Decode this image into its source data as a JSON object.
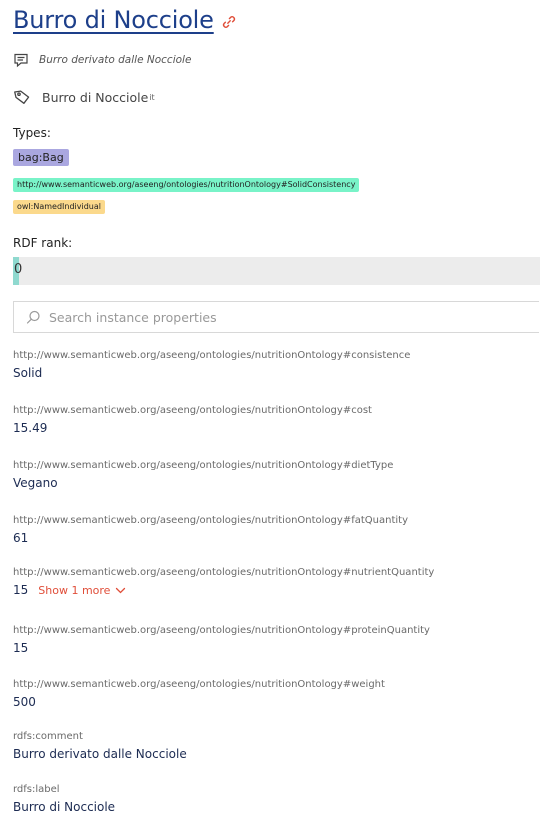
{
  "header": {
    "title": "Burro di Nocciole",
    "link_icon": "link-icon"
  },
  "description": {
    "icon": "comment-icon",
    "text": "Burro derivato dalle Nocciole"
  },
  "label": {
    "icon": "tag-icon",
    "text": "Burro di Nocciole",
    "lang": "it"
  },
  "types": {
    "heading": "Types:",
    "items": [
      {
        "label": "bag:Bag",
        "color": "#aaa7e0"
      },
      {
        "label": "http://www.semanticweb.org/aseeng/ontologies/nutritionOntology#SolidConsistency",
        "color": "#79f3c8"
      },
      {
        "label": "owl:NamedIndividual",
        "color": "#fbd98c"
      }
    ]
  },
  "rdf_rank": {
    "heading": "RDF rank:",
    "value": "0",
    "fill_color": "#8fd9cf"
  },
  "search": {
    "placeholder": "Search instance properties",
    "icon": "search-icon"
  },
  "properties": [
    {
      "key": "http://www.semanticweb.org/aseeng/ontologies/nutritionOntology#consistence",
      "value": "Solid"
    },
    {
      "key": "http://www.semanticweb.org/aseeng/ontologies/nutritionOntology#cost",
      "value": "15.49"
    },
    {
      "key": "http://www.semanticweb.org/aseeng/ontologies/nutritionOntology#dietType",
      "value": "Vegano"
    },
    {
      "key": "http://www.semanticweb.org/aseeng/ontologies/nutritionOntology#fatQuantity",
      "value": "61"
    },
    {
      "key": "http://www.semanticweb.org/aseeng/ontologies/nutritionOntology#nutrientQuantity",
      "value": "15",
      "show_more": "Show 1 more"
    },
    {
      "key": "http://www.semanticweb.org/aseeng/ontologies/nutritionOntology#proteinQuantity",
      "value": "15"
    },
    {
      "key": "http://www.semanticweb.org/aseeng/ontologies/nutritionOntology#weight",
      "value": "500"
    },
    {
      "key": "rdfs:comment",
      "value": "Burro derivato dalle Nocciole"
    },
    {
      "key": "rdfs:label",
      "value": "Burro di Nocciole"
    }
  ]
}
